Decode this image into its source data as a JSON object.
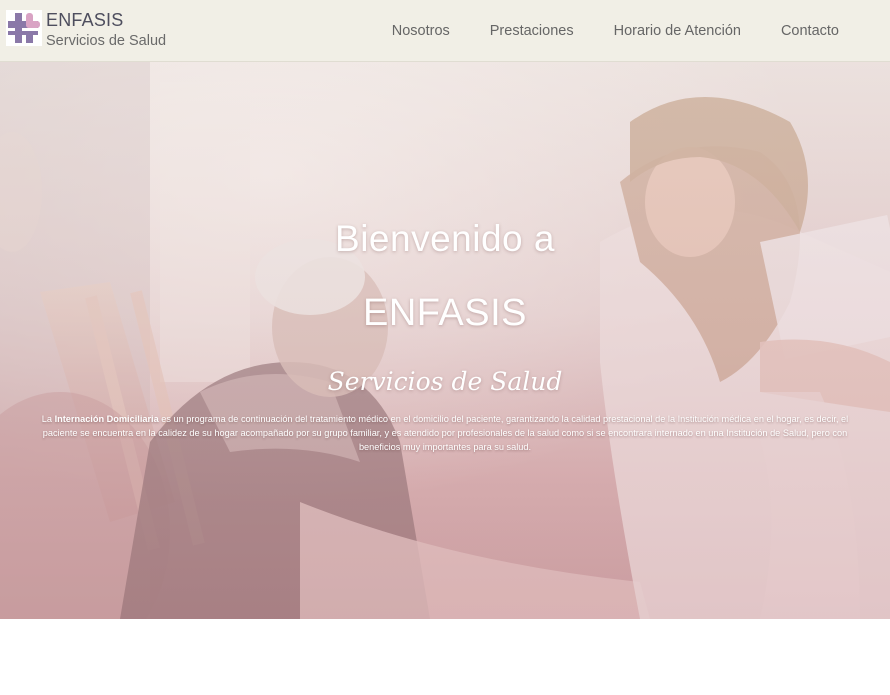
{
  "header": {
    "brand_name": "ENFASIS",
    "brand_subtitle": "Servicios de Salud",
    "logo_icon": "medical-cross-logo-icon",
    "nav": [
      {
        "label": "Nosotros"
      },
      {
        "label": "Prestaciones"
      },
      {
        "label": "Horario de Atención"
      },
      {
        "label": "Contacto"
      }
    ]
  },
  "hero": {
    "welcome": "Bienvenido a",
    "brand": "ENFASIS",
    "subtitle": "Servicios de Salud",
    "description_prefix": "La ",
    "description_bold": "Internación Domiciliaria",
    "description_rest": " es un programa de continuación del tratamiento médico en el domicilio del paciente, garantizando la calidad prestacional de la Institución médica en el hogar, es decir, el paciente se encuentra en la calidez de su hogar acompañado por su grupo familiar, y es atendido por profesionales de la salud como si se encontrara internado en una Institución de Salud, pero con beneficios muy importantes para su salud."
  },
  "colors": {
    "navbar_bg": "#f1efe6",
    "nav_text": "#666666",
    "logo_purple": "#8a78a8",
    "logo_pink": "#d9a3c4",
    "hero_tint": "#d6aeb0"
  }
}
